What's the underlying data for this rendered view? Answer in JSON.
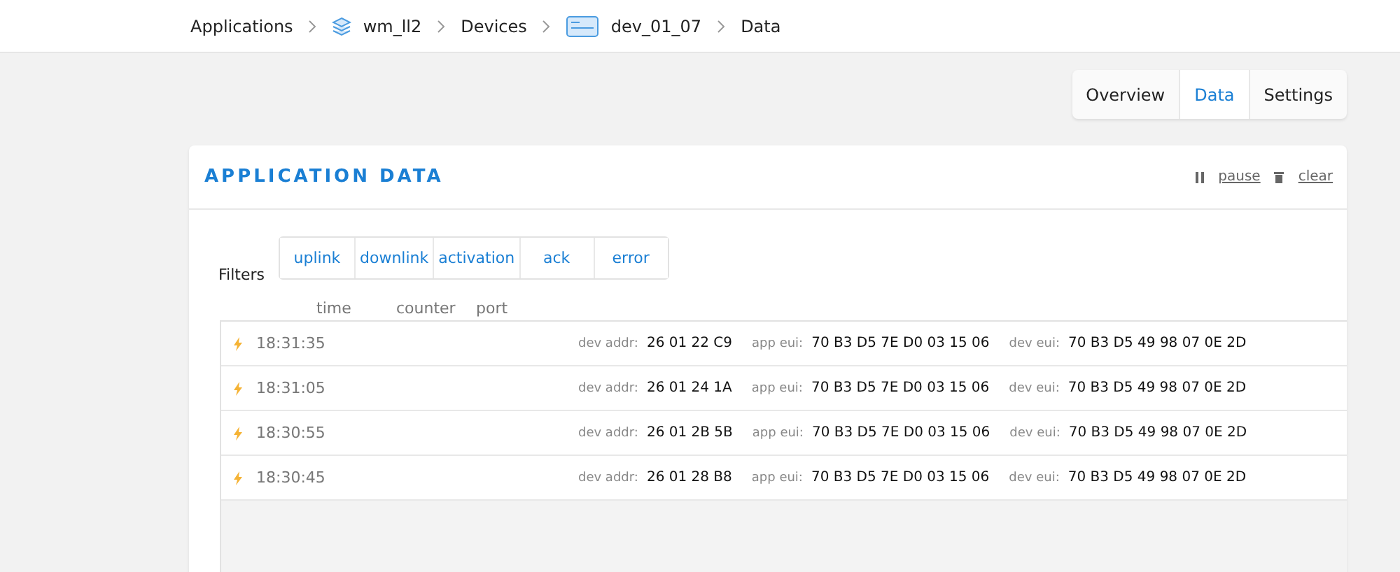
{
  "breadcrumb": [
    {
      "kind": "plain",
      "label": "Applications"
    },
    {
      "kind": "application",
      "label": "wm_ll2"
    },
    {
      "kind": "plain",
      "label": "Devices"
    },
    {
      "kind": "device",
      "label": "dev_01_07"
    },
    {
      "kind": "plain",
      "label": "Data"
    }
  ],
  "tabs": [
    {
      "label": "Overview",
      "selected": false
    },
    {
      "label": "Data",
      "selected": true
    },
    {
      "label": "Settings",
      "selected": false
    }
  ],
  "card": {
    "title": "APPLICATION DATA",
    "actions": [
      {
        "kind": "pause",
        "label": "pause"
      },
      {
        "kind": "clear",
        "label": "clear"
      }
    ]
  },
  "filters": {
    "label": "Filters",
    "items": [
      "uplink",
      "downlink",
      "activation",
      "ack",
      "error"
    ]
  },
  "columns": [
    "time",
    "counter",
    "port"
  ],
  "rows": [
    {
      "time": "18:31:35",
      "fields": [
        {
          "label": "dev addr:",
          "value": "26 01 22 C9"
        },
        {
          "label": "app eui:",
          "value": "70 B3 D5 7E D0 03 15 06"
        },
        {
          "label": "dev eui:",
          "value": "70 B3 D5 49 98 07 0E 2D"
        }
      ]
    },
    {
      "time": "18:31:05",
      "fields": [
        {
          "label": "dev addr:",
          "value": "26 01 24 1A"
        },
        {
          "label": "app eui:",
          "value": "70 B3 D5 7E D0 03 15 06"
        },
        {
          "label": "dev eui:",
          "value": "70 B3 D5 49 98 07 0E 2D"
        }
      ]
    },
    {
      "time": "18:30:55",
      "fields": [
        {
          "label": "dev addr:",
          "value": "26 01 2B 5B"
        },
        {
          "label": "app eui:",
          "value": "70 B3 D5 7E D0 03 15 06"
        },
        {
          "label": "dev eui:",
          "value": "70 B3 D5 49 98 07 0E 2D"
        }
      ]
    },
    {
      "time": "18:30:45",
      "fields": [
        {
          "label": "dev addr:",
          "value": "26 01 28 B8"
        },
        {
          "label": "app eui:",
          "value": "70 B3 D5 7E D0 03 15 06"
        },
        {
          "label": "dev eui:",
          "value": "70 B3 D5 49 98 07 0E 2D"
        }
      ]
    }
  ]
}
